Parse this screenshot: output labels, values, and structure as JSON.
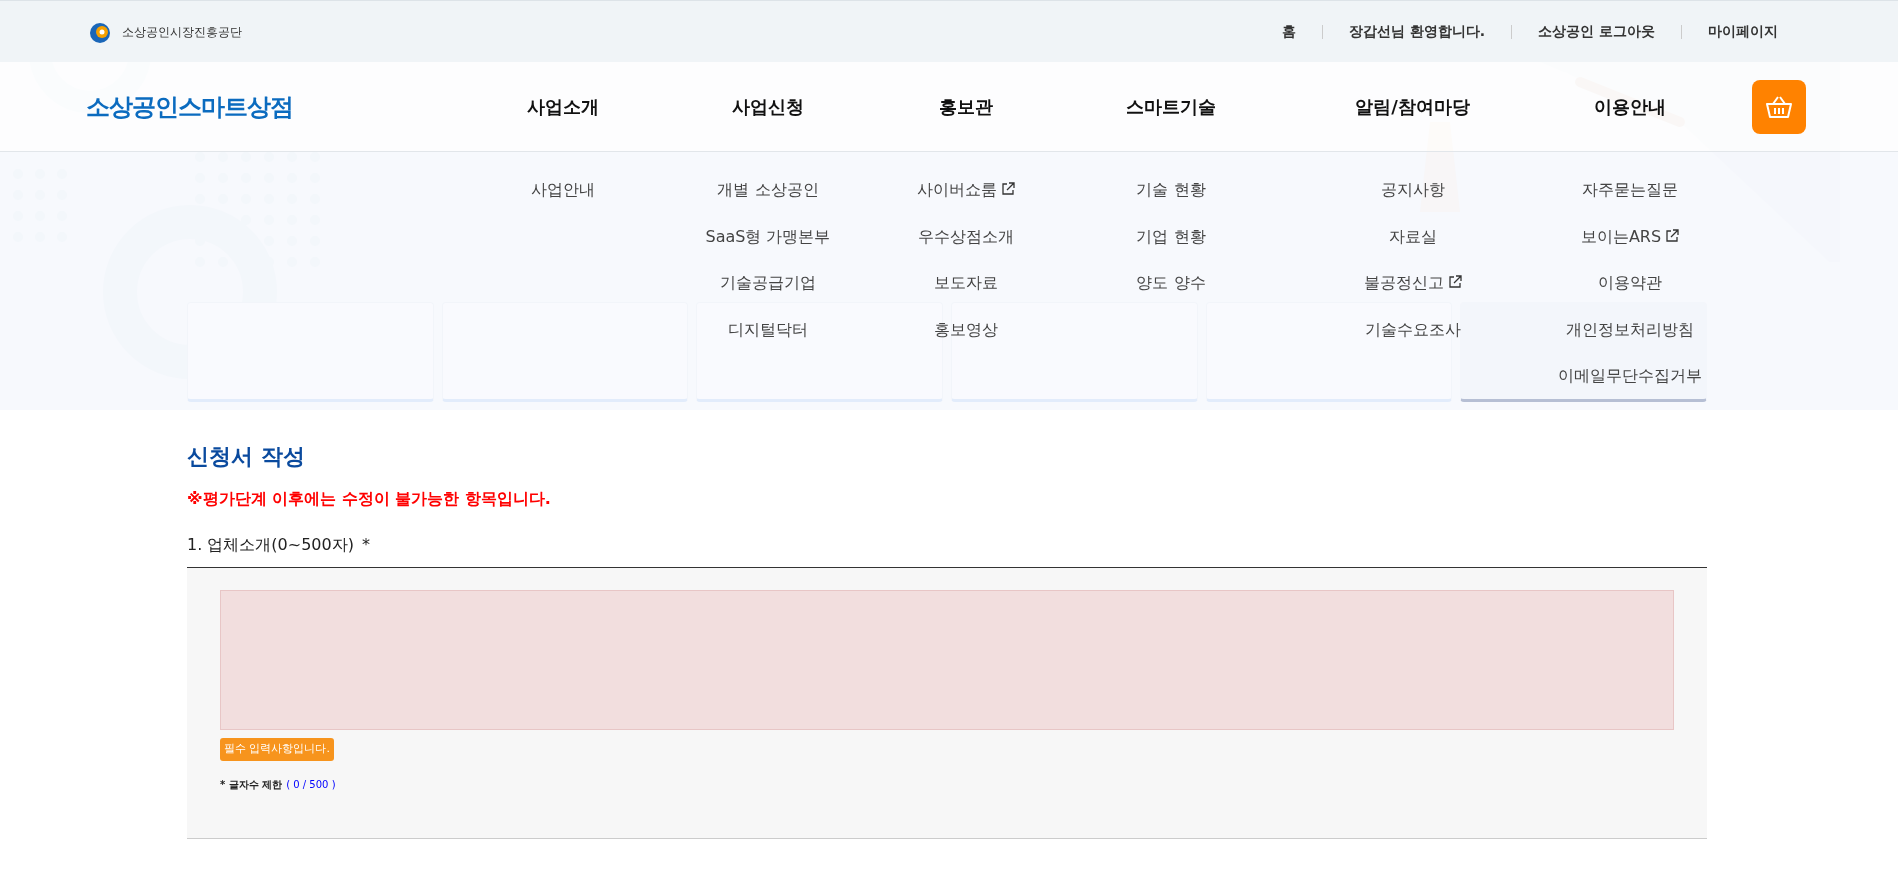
{
  "top_bar": {
    "org_name": "소상공인시장진흥공단",
    "links": [
      "홈",
      "장갑선님 환영합니다.",
      "소상공인 로그아웃",
      "마이페이지"
    ]
  },
  "header": {
    "logo": "소상공인스마트상점",
    "menus": [
      {
        "label": "사업소개",
        "items": [
          {
            "label": "사업안내",
            "external": false
          }
        ]
      },
      {
        "label": "사업신청",
        "items": [
          {
            "label": "개별 소상공인",
            "external": false
          },
          {
            "label": "SaaS형 가맹본부",
            "external": false
          },
          {
            "label": "기술공급기업",
            "external": false
          },
          {
            "label": "디지털닥터",
            "external": false
          }
        ]
      },
      {
        "label": "홍보관",
        "items": [
          {
            "label": "사이버쇼룸",
            "external": true
          },
          {
            "label": "우수상점소개",
            "external": false
          },
          {
            "label": "보도자료",
            "external": false
          },
          {
            "label": "홍보영상",
            "external": false
          }
        ]
      },
      {
        "label": "스마트기술",
        "items": [
          {
            "label": "기술 현황",
            "external": false
          },
          {
            "label": "기업 현황",
            "external": false
          },
          {
            "label": "양도 양수",
            "external": false
          }
        ]
      },
      {
        "label": "알림/참여마당",
        "items": [
          {
            "label": "공지사항",
            "external": false
          },
          {
            "label": "자료실",
            "external": false
          },
          {
            "label": "불공정신고",
            "external": true
          },
          {
            "label": "기술수요조사",
            "external": false
          }
        ]
      },
      {
        "label": "이용안내",
        "items": [
          {
            "label": "자주묻는질문",
            "external": false
          },
          {
            "label": "보이는ARS",
            "external": true
          },
          {
            "label": "이용약관",
            "external": false
          },
          {
            "label": "개인정보처리방침",
            "external": false
          },
          {
            "label": "이메일무단수집거부",
            "external": false
          }
        ]
      }
    ]
  },
  "hero": {
    "steps": [
      {
        "selected": false
      },
      {
        "selected": false
      },
      {
        "selected": false
      },
      {
        "selected": false
      },
      {
        "selected": false
      },
      {
        "selected": true
      }
    ]
  },
  "form": {
    "title": "신청서 작성",
    "warning": "※평가단계 이후에는 수정이 불가능한 항목입니다.",
    "fields": [
      {
        "label": "1. 업체소개(0~500자)",
        "required_mark": "*",
        "invalid": true,
        "error": "필수 입력사항입니다.",
        "limit_label": "* 글자수 제한",
        "counter": "( 0 / 500 )"
      }
    ]
  }
}
